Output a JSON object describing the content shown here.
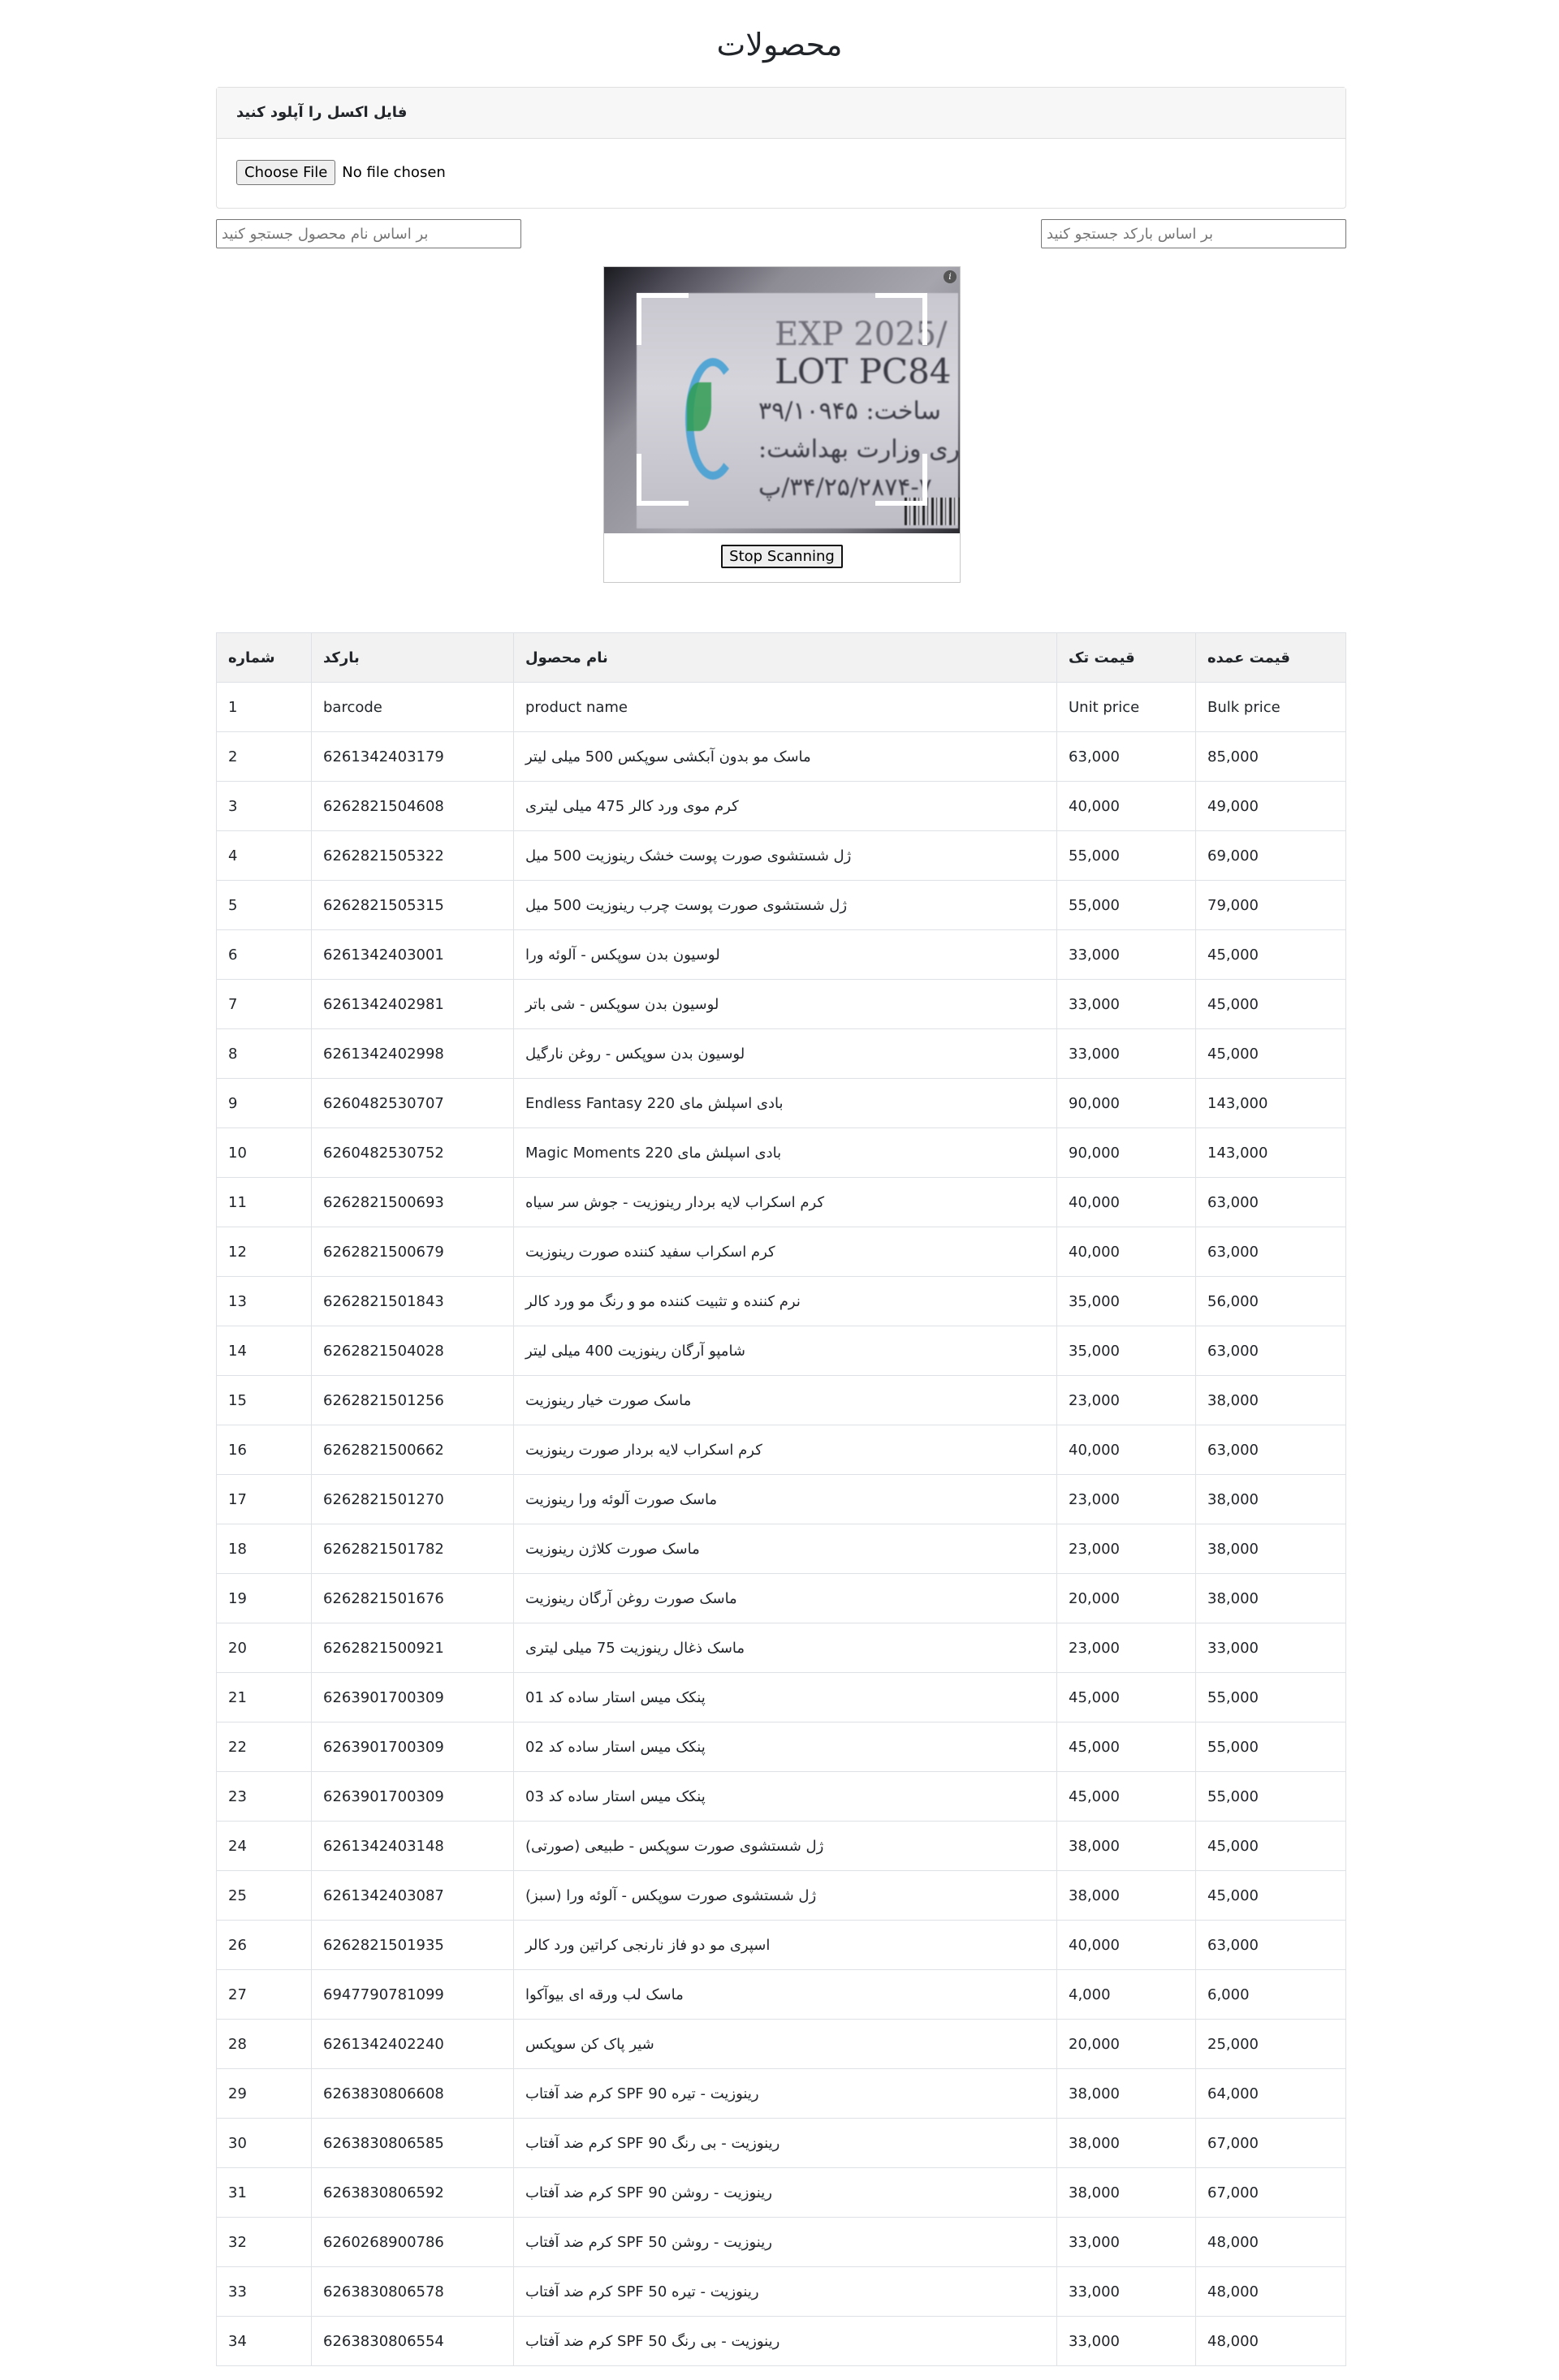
{
  "page": {
    "title": "محصولات"
  },
  "upload": {
    "header": "فایل اکسل را آپلود کنید",
    "button_label": "Choose File",
    "status": "No file chosen"
  },
  "search": {
    "name_placeholder": "بر اساس نام محصول جستجو کنید",
    "barcode_placeholder": "بر اساس بارکد جستجو کنید"
  },
  "scanner": {
    "camera_text": [
      "EXP 2025/",
      "LOT PC84",
      "ساخت: ۳۹/۱۰۹۴۵",
      "برداری وزارت بهداشت:",
      "۳۴/۲۵/۲۸۷۴-۷/پ"
    ],
    "stop_label": "Stop Scanning",
    "info_glyph": "i"
  },
  "table": {
    "headers": {
      "number": "شماره",
      "barcode": "بارکد",
      "name": "نام محصول",
      "unit_price": "قیمت تک",
      "bulk_price": "قیمت عمده"
    },
    "rows": [
      [
        "1",
        "barcode",
        "product name",
        "Unit price",
        "Bulk price"
      ],
      [
        "2",
        "6261342403179",
        "ماسک مو بدون آبکشی سوپکس 500 میلی لیتر",
        "63,000",
        "85,000"
      ],
      [
        "3",
        "6262821504608",
        "کرم موی ورد کالر 475 میلی لیتری",
        "40,000",
        "49,000"
      ],
      [
        "4",
        "6262821505322",
        "ژل شستشوی صورت پوست خشک رینوزیت 500 میل",
        "55,000",
        "69,000"
      ],
      [
        "5",
        "6262821505315",
        "ژل شستشوی صورت پوست چرب رینوزیت 500 میل",
        "55,000",
        "79,000"
      ],
      [
        "6",
        "6261342403001",
        "لوسیون بدن سوپکس - آلوئه ورا",
        "33,000",
        "45,000"
      ],
      [
        "7",
        "6261342402981",
        "لوسیون بدن سوپکس - شی باتر",
        "33,000",
        "45,000"
      ],
      [
        "8",
        "6261342402998",
        "لوسیون بدن سوپکس - روغن نارگیل",
        "33,000",
        "45,000"
      ],
      [
        "9",
        "6260482530707",
        "بادی اسپلش مای Endless Fantasy 220",
        "90,000",
        "143,000"
      ],
      [
        "10",
        "6260482530752",
        "بادی اسپلش مای Magic Moments 220",
        "90,000",
        "143,000"
      ],
      [
        "11",
        "6262821500693",
        "کرم اسکراب لایه بردار رینوزیت - جوش سر سیاه",
        "40,000",
        "63,000"
      ],
      [
        "12",
        "6262821500679",
        "کرم اسکراب سفید کننده صورت رینوزیت",
        "40,000",
        "63,000"
      ],
      [
        "13",
        "6262821501843",
        "نرم کننده و تثبیت کننده مو و رنگ مو ورد کالر",
        "35,000",
        "56,000"
      ],
      [
        "14",
        "6262821504028",
        "شامپو آرگان رینوزیت 400 میلی لیتر",
        "35,000",
        "63,000"
      ],
      [
        "15",
        "6262821501256",
        "ماسک صورت خیار رینوزیت",
        "23,000",
        "38,000"
      ],
      [
        "16",
        "6262821500662",
        "کرم اسکراب لایه بردار صورت رینوزیت",
        "40,000",
        "63,000"
      ],
      [
        "17",
        "6262821501270",
        "ماسک صورت آلوئه ورا رینوزیت",
        "23,000",
        "38,000"
      ],
      [
        "18",
        "6262821501782",
        "ماسک صورت کلاژن رینوزیت",
        "23,000",
        "38,000"
      ],
      [
        "19",
        "6262821501676",
        "ماسک صورت روغن آرگان رینوزیت",
        "20,000",
        "38,000"
      ],
      [
        "20",
        "6262821500921",
        "ماسک ذغال رینوزیت 75 میلی لیتری",
        "23,000",
        "33,000"
      ],
      [
        "21",
        "6263901700309",
        "پنکک میس استار ساده کد 01",
        "45,000",
        "55,000"
      ],
      [
        "22",
        "6263901700309",
        "پنکک میس استار ساده کد 02",
        "45,000",
        "55,000"
      ],
      [
        "23",
        "6263901700309",
        "پنکک میس استار ساده کد 03",
        "45,000",
        "55,000"
      ],
      [
        "24",
        "6261342403148",
        "ژل شستشوی صورت سوپکس - طبیعی (صورتی)",
        "38,000",
        "45,000"
      ],
      [
        "25",
        "6261342403087",
        "ژل شستشوی صورت سوپکس - آلوئه ورا (سبز)",
        "38,000",
        "45,000"
      ],
      [
        "26",
        "6262821501935",
        "اسپری مو دو فاز نارنجی کراتین ورد کالر",
        "40,000",
        "63,000"
      ],
      [
        "27",
        "6947790781099",
        "ماسک لب ورقه ای بیوآکوا",
        "4,000",
        "6,000"
      ],
      [
        "28",
        "6261342402240",
        "شیر پاک کن سوپکس",
        "20,000",
        "25,000"
      ],
      [
        "29",
        "6263830806608",
        "رینوزیت - تیره SPF 90 کرم ضد آفتاب",
        "38,000",
        "64,000"
      ],
      [
        "30",
        "6263830806585",
        "رینوزیت - بی رنگ SPF 90 کرم ضد آفتاب",
        "38,000",
        "67,000"
      ],
      [
        "31",
        "6263830806592",
        "رینوزیت - روشن SPF 90 کرم ضد آفتاب",
        "38,000",
        "67,000"
      ],
      [
        "32",
        "6260268900786",
        "رینوزیت - روشن SPF 50 کرم ضد آفتاب",
        "33,000",
        "48,000"
      ],
      [
        "33",
        "6263830806578",
        "رینوزیت - تیره SPF 50 کرم ضد آفتاب",
        "33,000",
        "48,000"
      ],
      [
        "34",
        "6263830806554",
        "رینوزیت - بی رنگ SPF 50 کرم ضد آفتاب",
        "33,000",
        "48,000"
      ]
    ]
  }
}
